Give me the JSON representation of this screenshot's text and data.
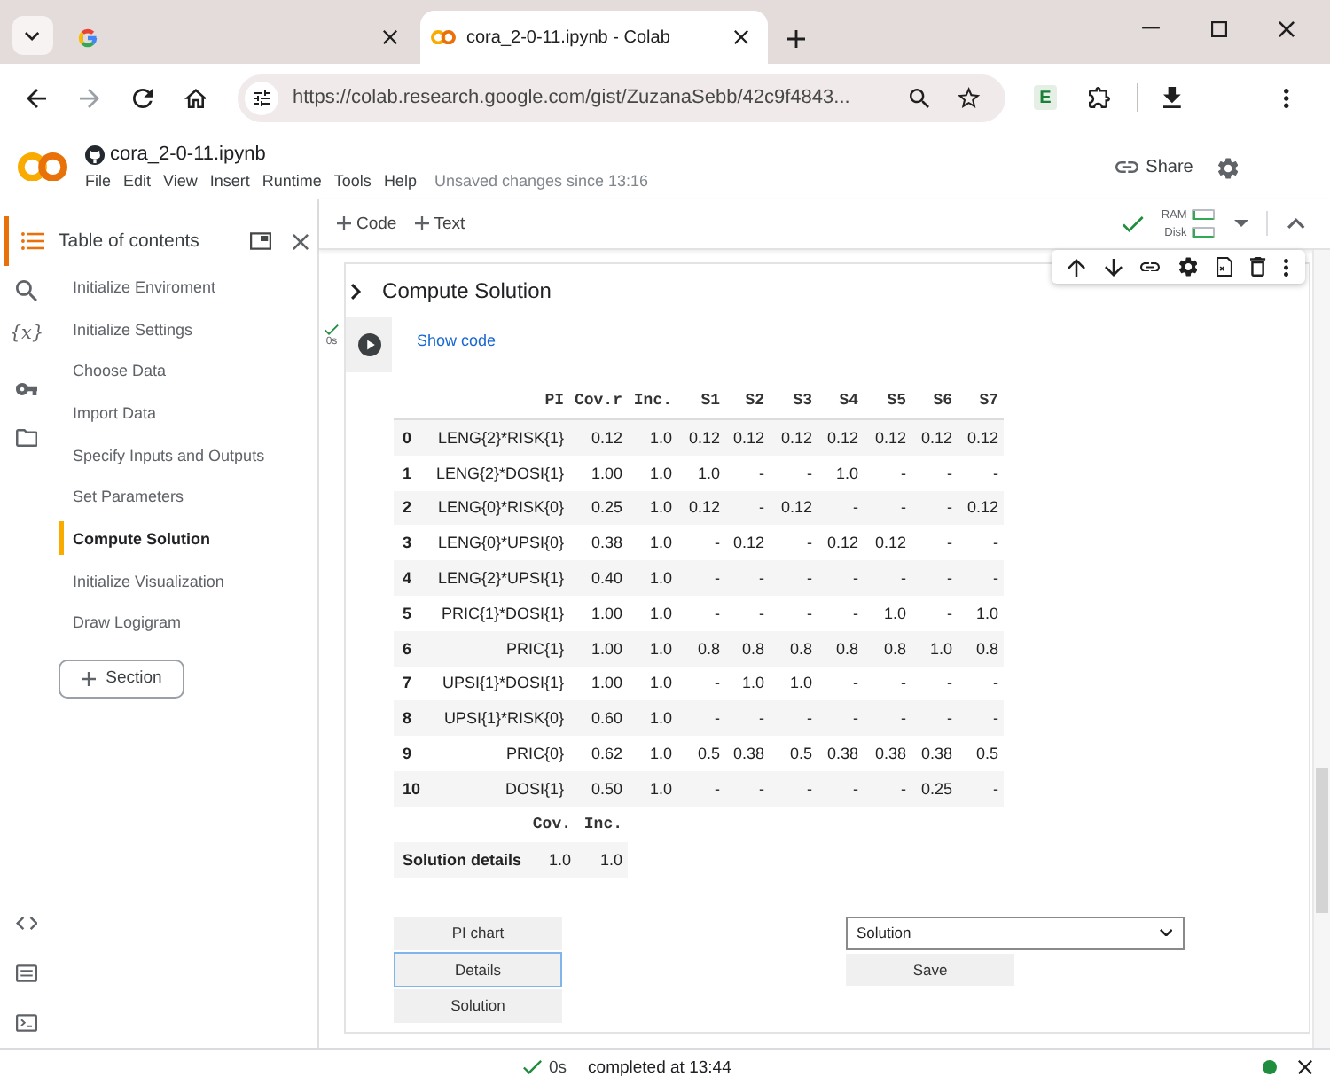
{
  "browser": {
    "tabs": [
      {
        "kind": "search_page",
        "selected": false
      },
      {
        "kind": "notebook",
        "title": "cora_2-0-11.ipynb - Colab",
        "selected": true
      }
    ],
    "address_bar": {
      "url": "https://colab.research.google.com/gist/ZuzanaSebb/42c9f4843..."
    },
    "extension_label": "E"
  },
  "notebook_header": {
    "title": "cora_2-0-11.ipynb",
    "menu": [
      "File",
      "Edit",
      "View",
      "Insert",
      "Runtime",
      "Tools",
      "Help"
    ],
    "save_status": "Unsaved changes since 13:16",
    "share": "Share"
  },
  "sidebar": {
    "rail": {
      "variables_glyph": "{x}"
    },
    "title": "Table of contents",
    "items": [
      {
        "label": "Initialize Enviroment",
        "selected": false
      },
      {
        "label": "Initialize Settings",
        "selected": false
      },
      {
        "label": "Choose Data",
        "selected": false
      },
      {
        "label": "Import Data",
        "selected": false
      },
      {
        "label": "Specify Inputs and Outputs",
        "selected": false
      },
      {
        "label": "Set Parameters",
        "selected": false
      },
      {
        "label": "Compute Solution",
        "selected": true
      },
      {
        "label": "Initialize Visualization",
        "selected": false
      },
      {
        "label": "Draw Logigram",
        "selected": false
      }
    ],
    "add_section": "Section"
  },
  "toolbar": {
    "add_code": "Code",
    "add_text": "Text",
    "connected": true,
    "resources": [
      {
        "label": "RAM",
        "level": 0.1
      },
      {
        "label": "Disk",
        "level": 0.1
      }
    ]
  },
  "cell": {
    "title": "Compute Solution",
    "run_time": "0s",
    "show_code": "Show code",
    "table": {
      "columns": [
        "PI",
        "Cov.r",
        "Inc.",
        "S1",
        "S2",
        "S3",
        "S4",
        "S5",
        "S6",
        "S7"
      ],
      "rows": [
        {
          "index": "0",
          "cells": [
            "LENG{2}*RISK{1}",
            "0.12",
            "1.0",
            "0.12",
            "0.12",
            "0.12",
            "0.12",
            "0.12",
            "0.12",
            "0.12"
          ]
        },
        {
          "index": "1",
          "cells": [
            "LENG{2}*DOSI{1}",
            "1.00",
            "1.0",
            "1.0",
            "-",
            "-",
            "1.0",
            "-",
            "-",
            "-"
          ]
        },
        {
          "index": "2",
          "cells": [
            "LENG{0}*RISK{0}",
            "0.25",
            "1.0",
            "0.12",
            "-",
            "0.12",
            "-",
            "-",
            "-",
            "0.12"
          ]
        },
        {
          "index": "3",
          "cells": [
            "LENG{0}*UPSI{0}",
            "0.38",
            "1.0",
            "-",
            "0.12",
            "-",
            "0.12",
            "0.12",
            "-",
            "-"
          ]
        },
        {
          "index": "4",
          "cells": [
            "LENG{2}*UPSI{1}",
            "0.40",
            "1.0",
            "-",
            "-",
            "-",
            "-",
            "-",
            "-",
            "-"
          ]
        },
        {
          "index": "5",
          "cells": [
            "PRIC{1}*DOSI{1}",
            "1.00",
            "1.0",
            "-",
            "-",
            "-",
            "-",
            "1.0",
            "-",
            "1.0"
          ]
        },
        {
          "index": "6",
          "cells": [
            "PRIC{1}",
            "1.00",
            "1.0",
            "0.8",
            "0.8",
            "0.8",
            "0.8",
            "0.8",
            "1.0",
            "0.8"
          ]
        },
        {
          "index": "7",
          "cells": [
            "UPSI{1}*DOSI{1}",
            "1.00",
            "1.0",
            "-",
            "1.0",
            "1.0",
            "-",
            "-",
            "-",
            "-"
          ]
        },
        {
          "index": "8",
          "cells": [
            "UPSI{1}*RISK{0}",
            "0.60",
            "1.0",
            "-",
            "-",
            "-",
            "-",
            "-",
            "-",
            "-"
          ]
        },
        {
          "index": "9",
          "cells": [
            "PRIC{0}",
            "0.62",
            "1.0",
            "0.5",
            "0.38",
            "0.5",
            "0.38",
            "0.38",
            "0.38",
            "0.5"
          ]
        },
        {
          "index": "10",
          "cells": [
            "DOSI{1}",
            "0.50",
            "1.0",
            "-",
            "-",
            "-",
            "-",
            "-",
            "0.25",
            "-"
          ]
        }
      ]
    },
    "summary": {
      "columns": [
        "Cov.",
        "Inc."
      ],
      "rows": [
        {
          "label": "Solution details",
          "cells": [
            "1.0",
            "1.0"
          ]
        }
      ]
    },
    "buttons": [
      {
        "label": "PI chart",
        "focused": false
      },
      {
        "label": "Details",
        "focused": true
      },
      {
        "label": "Solution",
        "focused": false
      }
    ],
    "dropdown": {
      "value": "Solution"
    },
    "save": "Save"
  },
  "status_bar": {
    "duration": "0s",
    "message": "completed at 13:44",
    "connected": true
  }
}
